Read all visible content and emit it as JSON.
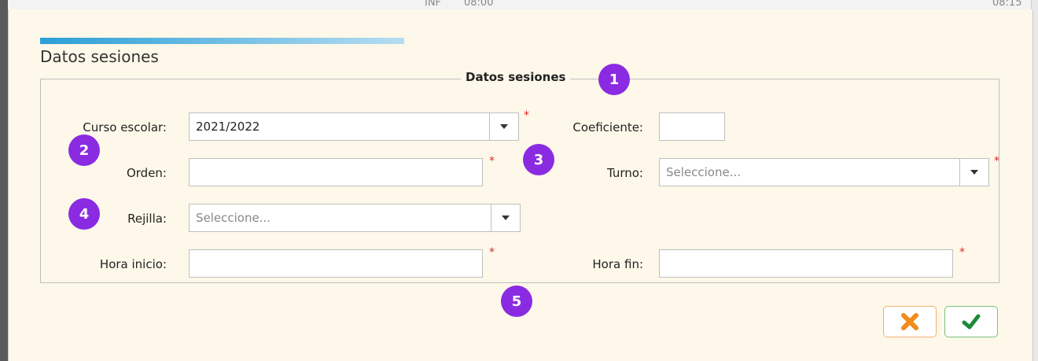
{
  "background": {
    "header_text_1": "INF",
    "header_text_2": "08:00",
    "header_text_3": "08:15"
  },
  "modal": {
    "title": "Datos sesiones"
  },
  "group": {
    "legend": "Datos sesiones"
  },
  "form": {
    "curso_escolar": {
      "label": "Curso escolar:",
      "value": "2021/2022",
      "required": "*"
    },
    "coeficiente": {
      "label": "Coeficiente:",
      "value": ""
    },
    "orden": {
      "label": "Orden:",
      "value": "",
      "required": "*"
    },
    "turno": {
      "label": "Turno:",
      "placeholder": "Seleccione...",
      "required": "*"
    },
    "rejilla": {
      "label": "Rejilla:",
      "placeholder": "Seleccione..."
    },
    "hora_inicio": {
      "label": "Hora inicio:",
      "value": "",
      "required": "*"
    },
    "hora_fin": {
      "label": "Hora fin:",
      "value": "",
      "required": "*"
    }
  },
  "annotations": [
    "1",
    "2",
    "3",
    "4",
    "5"
  ],
  "buttons": {
    "cancel_icon": "close-icon",
    "confirm_icon": "check-icon"
  },
  "colors": {
    "accent": "#2a9fd6",
    "badge": "#8a2be2",
    "cancel": "#f28c1b",
    "confirm": "#1e8a3a",
    "required": "#e02424",
    "modal_bg": "#fdf8e9"
  }
}
